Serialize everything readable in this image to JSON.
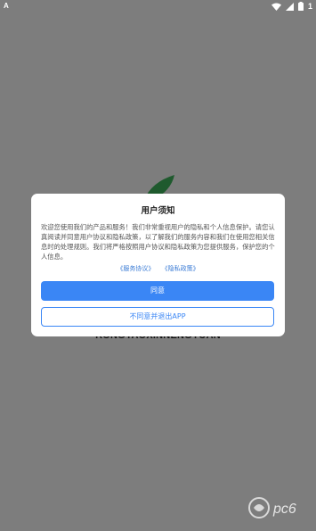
{
  "status_bar": {
    "left_icon": "A",
    "battery_text": "1",
    "icons": [
      "wifi-icon",
      "signal-icon",
      "battery-icon"
    ]
  },
  "background": {
    "brand_text": "RONGYAOXINNENGYUAN"
  },
  "dialog": {
    "title": "用户须知",
    "body": "欢迎您使用我们的产品和服务！我们非常重视用户的隐私和个人信息保护。请您认真阅读并同意用户协议和隐私政策，以了解我们的服务内容和我们在使用您相关信息时的处理规则。我们将严格按照用户协议和隐私政策为您提供服务，保护您的个人信息。",
    "link_service": "《服务协议》",
    "link_privacy": "《隐私政策》",
    "agree_label": "同意",
    "disagree_label": "不同意并退出APP"
  },
  "watermark": {
    "text": "pc6"
  },
  "colors": {
    "primary": "#3a86f5",
    "overlay": "#7d7d7d",
    "leaf": "#1f5a2e"
  }
}
